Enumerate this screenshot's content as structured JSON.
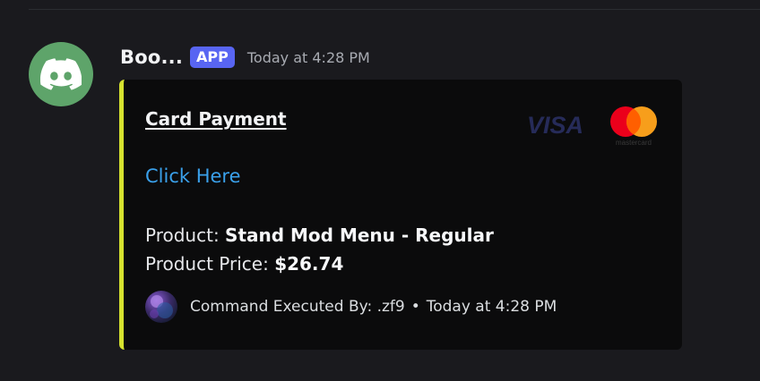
{
  "message": {
    "author": "Boo...",
    "badge": "APP",
    "timestamp": "Today at 4:28 PM"
  },
  "embed": {
    "accent_color": "#d6e22f",
    "title": "Card Payment",
    "link_text": "Click Here",
    "product_label": "Product: ",
    "product_value": "Stand Mod Menu - Regular",
    "price_label": "Product Price: ",
    "price_value": "$26.74",
    "logos": {
      "visa": "VISA",
      "mastercard": "mastercard"
    },
    "footer": {
      "text": "Command Executed By: .zf9",
      "separator": "•",
      "timestamp": "Today at 4:28 PM"
    }
  },
  "colors": {
    "background": "#1a1a1e",
    "avatar_bg": "#5ea46a",
    "badge_bg": "#5865f2",
    "link": "#3aa0ea"
  },
  "icons": {
    "bot_avatar": "discord-logo-icon"
  }
}
